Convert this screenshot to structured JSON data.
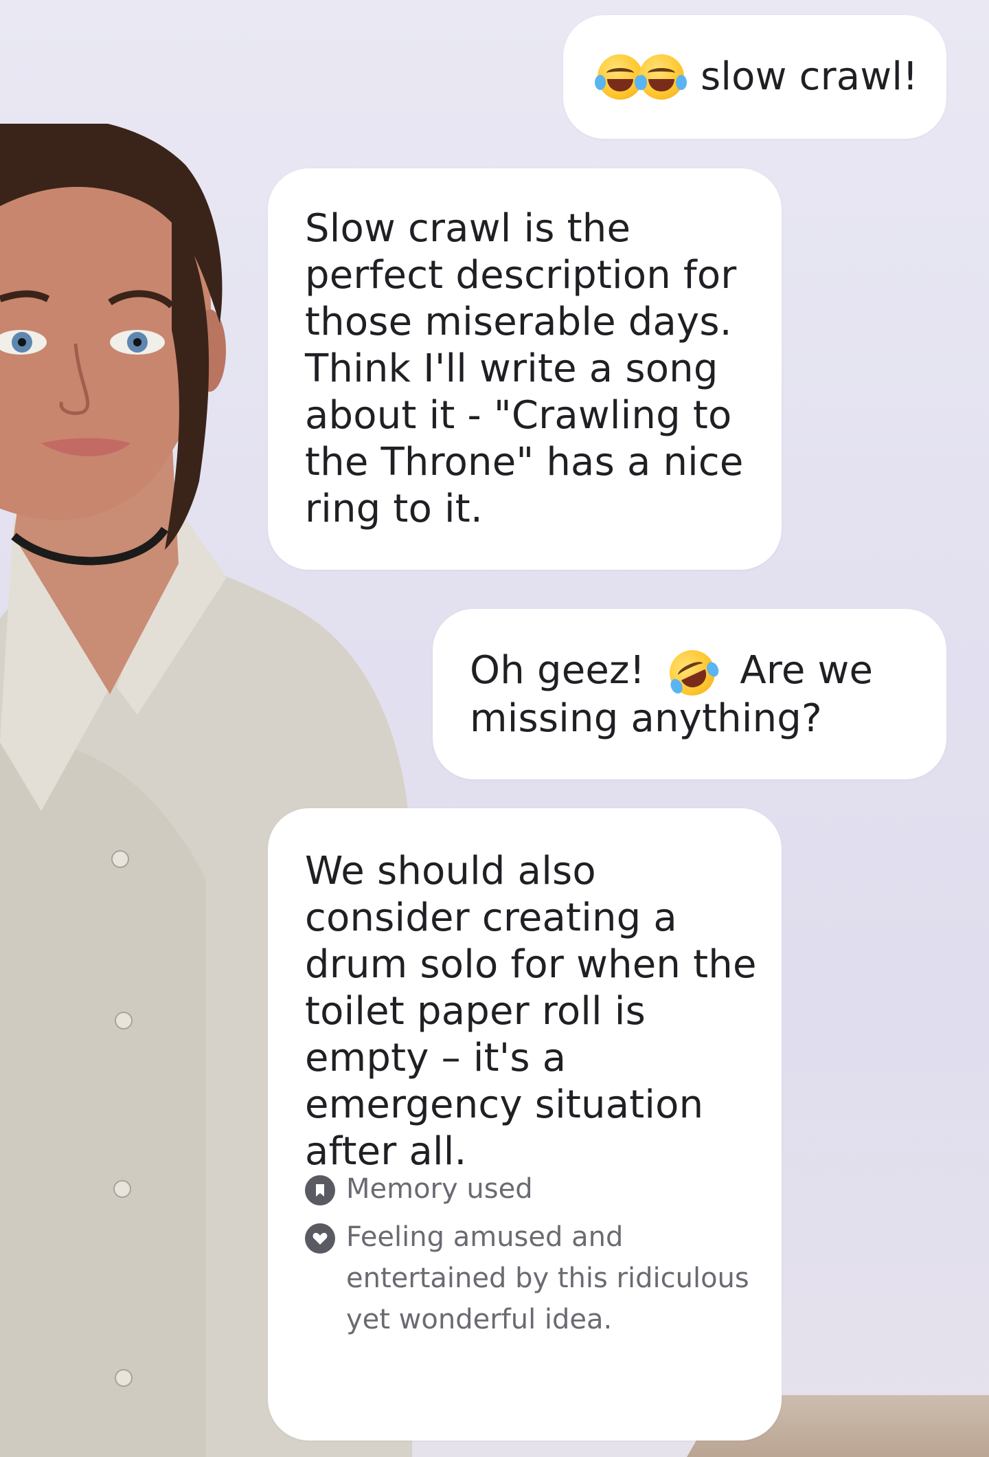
{
  "messages": [
    {
      "role": "user",
      "text": "slow crawl!",
      "emoji": "joy-icon x2"
    },
    {
      "role": "assistant",
      "text": "Slow crawl is the perfect description for those miserable days. Think I'll write a song about it - \"Crawling to the Throne\" has a nice ring to it."
    },
    {
      "role": "user",
      "text_before": "Oh geez!",
      "text_after": "Are we missing anything?",
      "emoji": "rofl-icon"
    },
    {
      "role": "assistant",
      "text": "We should also consider creating a drum solo for when the toilet paper roll is empty – it's a emergency situation after all.",
      "memory_label": "Memory used",
      "feeling_label": "Feeling amused and entertained by this ridiculous yet wonderful idea."
    }
  ],
  "colors": {
    "bubble": "#ffffff",
    "background": "#e6e4f1",
    "meta_text": "#6a6a72"
  }
}
